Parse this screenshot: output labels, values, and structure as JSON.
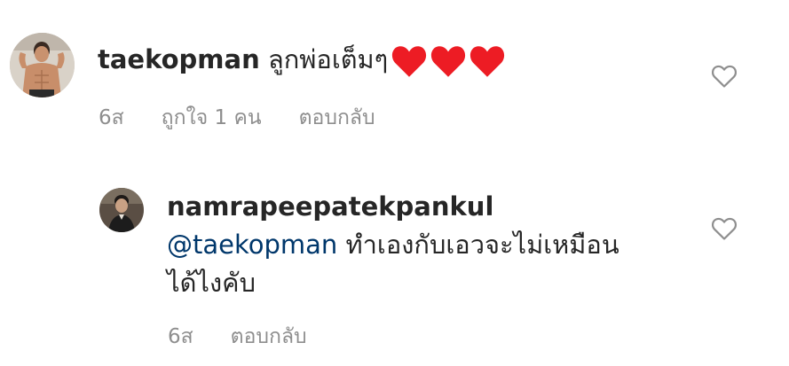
{
  "comments": [
    {
      "username": "taekopman",
      "text": "ลูกพ่อเต็มๆ",
      "emoji": [
        "red-heart",
        "red-heart",
        "red-heart"
      ],
      "time": "6ส",
      "likes": "ถูกใจ 1 คน",
      "reply_label": "ตอบกลับ",
      "avatar_icon": "profile-photo"
    },
    {
      "username": "namrapeepatekpankul",
      "mention": "@taekopman",
      "text_line1": "ทำเองกับเอวจะไม่เหมือน",
      "text_line2": "ได้ไงคับ",
      "time": "6ส",
      "reply_label": "ตอบกลับ",
      "avatar_icon": "profile-photo"
    }
  ],
  "colors": {
    "text": "#262626",
    "meta": "#8e8e8e",
    "mention": "#00376b",
    "heart": "#ed1c24"
  },
  "icons": {
    "like": "heart-outline-icon"
  }
}
